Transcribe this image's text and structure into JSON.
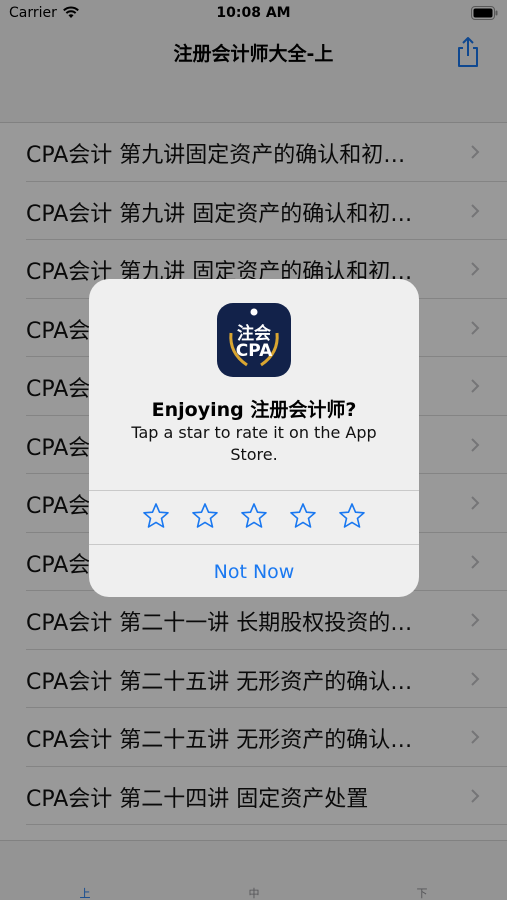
{
  "status": {
    "carrier": "Carrier",
    "time": "10:08 AM"
  },
  "nav": {
    "title": "注册会计师大全-上"
  },
  "list": {
    "items": [
      "CPA会计 第九讲固定资产的确认和初…",
      "CPA会计 第九讲 固定资产的确认和初…",
      "CPA会计 第九讲 固定资产的确认和初…",
      "CPA会计 第九讲 固定资产的确认和初…",
      "CPA会计 第九讲 固定资产的确认和初…",
      "CPA会计 第九讲 固定资产的确认和初…",
      "CPA会计 第九讲 固定资产的确认和初…",
      "CPA会计 第二十一讲 长期股权投资的…",
      "CPA会计 第二十一讲 长期股权投资的…",
      "CPA会计 第二十五讲 无形资产的确认…",
      "CPA会计 第二十五讲 无形资产的确认…",
      "CPA会计 第二十四讲 固定资产处置"
    ]
  },
  "tabs": [
    "上",
    "中",
    "下"
  ],
  "alert": {
    "app_icon_top": "注会",
    "app_icon_bottom": "CPA",
    "title": "Enjoying 注册会计师?",
    "message": "Tap a star to rate it on the App Store.",
    "rating": 0,
    "star_count": 5,
    "dismiss_label": "Not Now"
  },
  "colors": {
    "accent": "#1a78f0",
    "icon_bg": "#12224a",
    "overlay": "rgba(0,0,0,0.40)"
  }
}
